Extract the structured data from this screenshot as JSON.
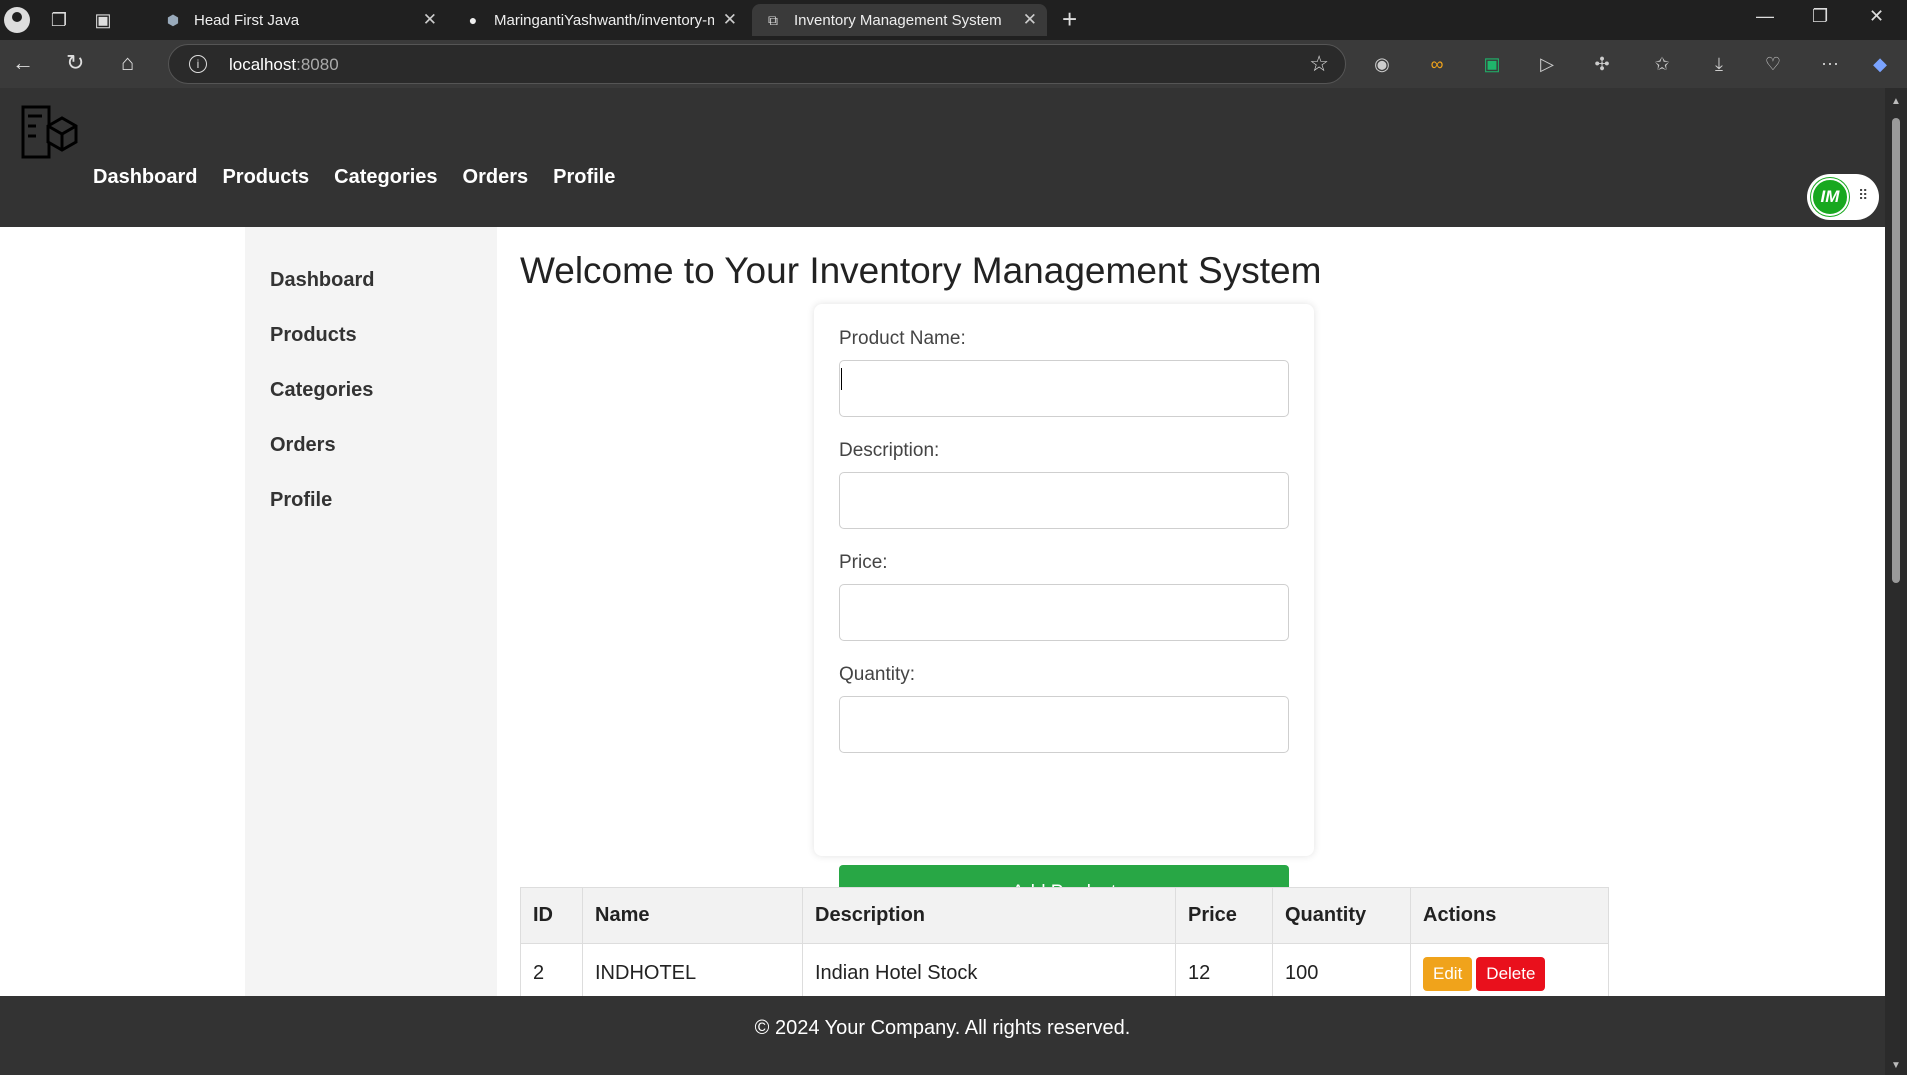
{
  "browser": {
    "tabs": [
      {
        "label": "Head First Java",
        "active": false
      },
      {
        "label": "MaringantiYashwanth/inventory-m",
        "active": false
      },
      {
        "label": "Inventory Management System",
        "active": true
      }
    ],
    "url_host": "localhost",
    "url_port": ":8080"
  },
  "app": {
    "topnav": [
      "Dashboard",
      "Products",
      "Categories",
      "Orders",
      "Profile"
    ],
    "avatar_initials": "IM",
    "sidebar": [
      "Dashboard",
      "Products",
      "Categories",
      "Orders",
      "Profile"
    ],
    "title": "Welcome to Your Inventory Management System",
    "form": {
      "fields": [
        {
          "label": "Product Name:",
          "value": ""
        },
        {
          "label": "Description:",
          "value": ""
        },
        {
          "label": "Price:",
          "value": ""
        },
        {
          "label": "Quantity:",
          "value": ""
        }
      ],
      "submit_label": "Add Product"
    },
    "table": {
      "headers": [
        "ID",
        "Name",
        "Description",
        "Price",
        "Quantity",
        "Actions"
      ],
      "rows": [
        {
          "id": "2",
          "name": "INDHOTEL",
          "description": "Indian Hotel Stock",
          "price": "12",
          "quantity": "100"
        }
      ],
      "edit_label": "Edit",
      "delete_label": "Delete"
    },
    "footer": "© 2024 Your Company. All rights reserved."
  },
  "colors": {
    "header_bg": "#333333",
    "add_button": "#28a745",
    "edit_button": "#f0a31b",
    "delete_button": "#e9101c",
    "avatar": "#18a81f"
  },
  "icons": [
    "profile-icon",
    "workspaces-icon",
    "tab-actions-icon",
    "github-icon",
    "back-icon",
    "reload-icon",
    "home-icon",
    "info-icon",
    "star-icon",
    "extensions-icon",
    "favorites-icon",
    "downloads-icon",
    "more-icon",
    "copilot-icon",
    "inventory-logo-icon"
  ]
}
